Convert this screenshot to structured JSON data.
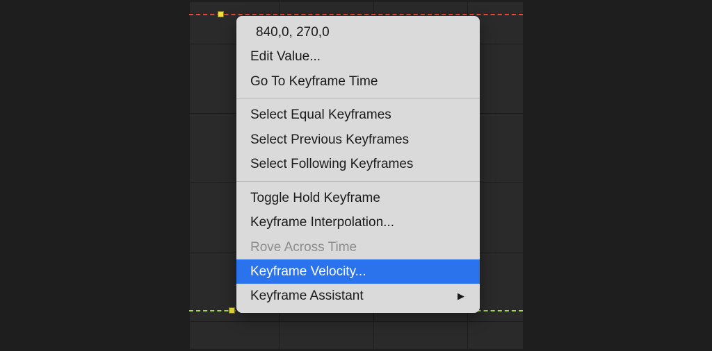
{
  "keyframe_value_display": "840,0, 270,0",
  "colors": {
    "curve_red": "#e34a3a",
    "curve_green": "#a2d94a",
    "keyframe_yellow": "#f0e03e",
    "highlight_blue": "#2b73ec"
  },
  "menu": {
    "groups": [
      {
        "items": [
          {
            "label_key": "value",
            "label": "840,0, 270,0",
            "enabled": true,
            "submenu": false
          },
          {
            "label_key": "edit",
            "label": "Edit Value...",
            "enabled": true,
            "submenu": false
          },
          {
            "label_key": "goto",
            "label": "Go To Keyframe Time",
            "enabled": true,
            "submenu": false
          }
        ]
      },
      {
        "items": [
          {
            "label_key": "sel_eq",
            "label": "Select Equal Keyframes",
            "enabled": true,
            "submenu": false
          },
          {
            "label_key": "sel_prev",
            "label": "Select Previous Keyframes",
            "enabled": true,
            "submenu": false
          },
          {
            "label_key": "sel_next",
            "label": "Select Following Keyframes",
            "enabled": true,
            "submenu": false
          }
        ]
      },
      {
        "items": [
          {
            "label_key": "toggle",
            "label": "Toggle Hold Keyframe",
            "enabled": true,
            "submenu": false
          },
          {
            "label_key": "interp",
            "label": "Keyframe Interpolation...",
            "enabled": true,
            "submenu": false
          },
          {
            "label_key": "rove",
            "label": "Rove Across Time",
            "enabled": false,
            "submenu": false
          },
          {
            "label_key": "velocity",
            "label": "Keyframe Velocity...",
            "enabled": true,
            "submenu": false,
            "highlighted": true
          },
          {
            "label_key": "assist",
            "label": "Keyframe Assistant",
            "enabled": true,
            "submenu": true
          }
        ]
      }
    ]
  }
}
